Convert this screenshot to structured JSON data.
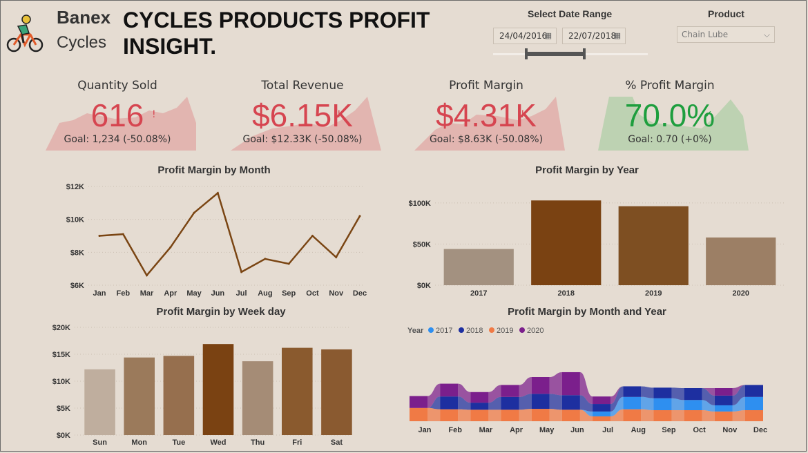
{
  "header": {
    "brand_line1": "Banex",
    "brand_line2": "Cycles",
    "title": "CYCLES PRODUCTS PROFIT INSIGHT.",
    "logo_icon": "cyclist-icon"
  },
  "filters": {
    "date_label": "Select Date Range",
    "date_start": "24/04/2016",
    "date_end": "22/07/2018",
    "product_label": "Product",
    "product_value": "Chain Lube"
  },
  "kpis": [
    {
      "title": "Quantity Sold",
      "value": "616",
      "goal": "Goal: 1,234 (-50.08%)",
      "status": "!",
      "color": "#d64550",
      "bg": "#e2b5b0"
    },
    {
      "title": "Total Revenue",
      "value": "$6.15K",
      "goal": "Goal: $12.33K (-50.08%)",
      "status": "!",
      "color": "#d64550",
      "bg": "#e2b5b0"
    },
    {
      "title": "Profit Margin",
      "value": "$4.31K",
      "goal": "Goal: $8.63K (-50.08%)",
      "status": "!",
      "color": "#d64550",
      "bg": "#e2b5b0"
    },
    {
      "title": "% Profit Margin",
      "value": "70.0%",
      "goal": "Goal: 0.70 (+0%)",
      "status": "✓",
      "color": "#1e9e3e",
      "bg": "#bdd2b2"
    }
  ],
  "chart_data": [
    {
      "type": "line",
      "title": "Profit Margin by Month",
      "categories": [
        "Jan",
        "Feb",
        "Mar",
        "Apr",
        "May",
        "Jun",
        "Jul",
        "Aug",
        "Sep",
        "Oct",
        "Nov",
        "Dec"
      ],
      "values": [
        9000,
        9100,
        6600,
        8300,
        10400,
        11600,
        6800,
        7600,
        7300,
        9000,
        7700,
        10200
      ],
      "ylim": [
        6000,
        12000
      ],
      "yticks": [
        6000,
        8000,
        10000,
        12000
      ],
      "ytick_labels": [
        "$6K",
        "$8K",
        "$10K",
        "$12K"
      ],
      "color": "#7a4513"
    },
    {
      "type": "bar",
      "title": "Profit Margin by Year",
      "categories": [
        "2017",
        "2018",
        "2019",
        "2020"
      ],
      "values": [
        44000,
        103000,
        96000,
        58000
      ],
      "colors": [
        "#a39180",
        "#7a4212",
        "#7e4f22",
        "#9c7f65"
      ],
      "ylim": [
        0,
        120000
      ],
      "yticks": [
        0,
        50000,
        100000
      ],
      "ytick_labels": [
        "$0K",
        "$50K",
        "$100K"
      ]
    },
    {
      "type": "bar",
      "title": "Profit Margin by Week day",
      "categories": [
        "Sun",
        "Mon",
        "Tue",
        "Wed",
        "Thu",
        "Fri",
        "Sat"
      ],
      "values": [
        12200,
        14400,
        14700,
        16900,
        13700,
        16200,
        15900
      ],
      "colors": [
        "#bfae9e",
        "#9b7a5b",
        "#966f4e",
        "#7a4212",
        "#a58c76",
        "#8a5a2e",
        "#8a5a30"
      ],
      "ylim": [
        0,
        20000
      ],
      "yticks": [
        0,
        5000,
        10000,
        15000,
        20000
      ],
      "ytick_labels": [
        "$0K",
        "$5K",
        "$10K",
        "$15K",
        "$20K"
      ]
    },
    {
      "type": "area",
      "title": "Profit Margin by Month and Year",
      "legend_title": "Year",
      "legend_position": "top-left",
      "categories": [
        "Jan",
        "Feb",
        "Mar",
        "Apr",
        "May",
        "Jun",
        "Jul",
        "Aug",
        "Sep",
        "Oct",
        "Nov",
        "Dec"
      ],
      "series": [
        {
          "name": "2017",
          "color": "#2e8ff0",
          "values": [
            0,
            0,
            0,
            0,
            0,
            0,
            1100,
            2800,
            2700,
            2300,
            1400,
            3000
          ]
        },
        {
          "name": "2018",
          "color": "#1d2fa0",
          "values": [
            0,
            2900,
            1600,
            2900,
            3400,
            3300,
            1700,
            2400,
            2400,
            2700,
            2200,
            2700
          ]
        },
        {
          "name": "2019",
          "color": "#f07a45",
          "values": [
            3000,
            2700,
            2600,
            2600,
            2800,
            2600,
            1100,
            2700,
            2500,
            2500,
            2200,
            2500
          ]
        },
        {
          "name": "2020",
          "color": "#7b1f8c",
          "values": [
            2700,
            2900,
            2400,
            2700,
            3800,
            5200,
            1700,
            0,
            0,
            0,
            1700,
            0
          ]
        }
      ]
    }
  ]
}
